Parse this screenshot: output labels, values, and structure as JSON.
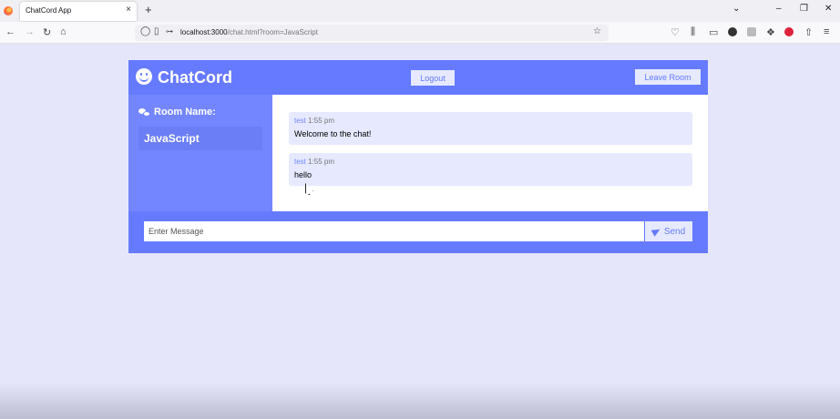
{
  "browser": {
    "tab_title": "ChatCord App",
    "tab_close": "⌄",
    "new_tab": "+",
    "url_host": "localhost:3000",
    "url_path": "/chat.html?room=JavaScript",
    "window_controls": [
      "⌄",
      "–",
      "❐",
      "✕"
    ]
  },
  "header": {
    "app_name": "ChatCord",
    "logout_label": "Logout",
    "leave_label": "Leave Room"
  },
  "sidebar": {
    "heading": "Room Name:",
    "room": "JavaScript"
  },
  "messages": [
    {
      "user": "test",
      "time": " 1:55 pm",
      "text": "Welcome to the chat!"
    },
    {
      "user": "test",
      "time": " 1:55 pm",
      "text": "hello"
    }
  ],
  "form": {
    "placeholder": "Enter Message",
    "send_label": "Send"
  },
  "colors": {
    "primary": "#667aff",
    "secondary": "#7386ff",
    "light": "#e6e9ff",
    "page_bg": "#e6e6fa"
  }
}
